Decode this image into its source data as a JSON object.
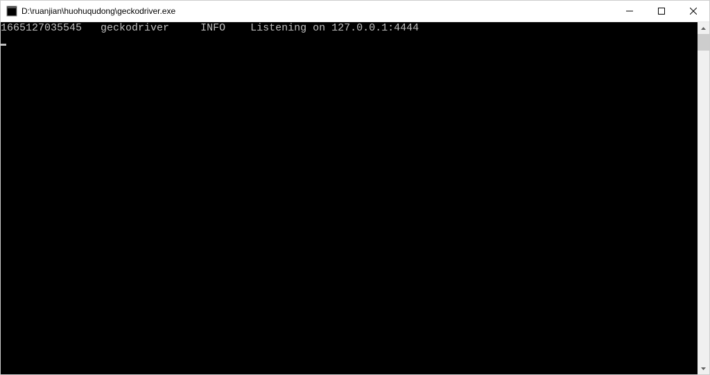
{
  "window": {
    "title": "D:\\ruanjian\\huohuqudong\\geckodriver.exe"
  },
  "terminal": {
    "lines": [
      {
        "timestamp": "1665127035545",
        "component": "geckodriver",
        "level": "INFO",
        "message": "Listening on 127.0.0.1:4444"
      }
    ]
  }
}
